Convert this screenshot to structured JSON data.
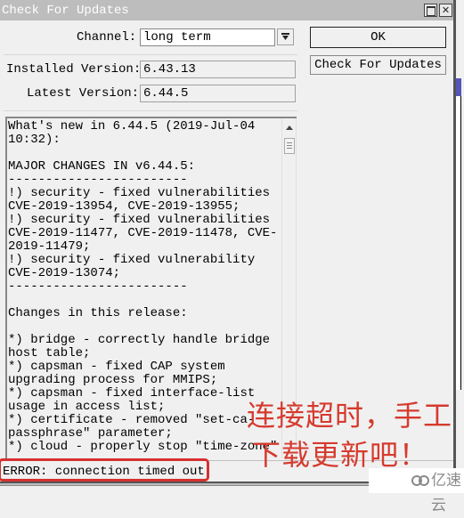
{
  "window": {
    "title": "Check For Updates",
    "maximize_icon": "maximize-icon",
    "close_glyph": "✕"
  },
  "form": {
    "channel_label": "Channel:",
    "channel_value": "long term",
    "installed_label": "Installed Version:",
    "installed_value": "6.43.13",
    "latest_label": "Latest Version:",
    "latest_value": "6.44.5"
  },
  "buttons": {
    "ok": "OK",
    "check": "Check For Updates"
  },
  "release_notes": {
    "text": "What's new in 6.44.5 (2019-Jul-04\n10:32):\n\nMAJOR CHANGES IN v6.44.5:\n------------------------\n!) security - fixed vulnerabilities\nCVE-2019-13954, CVE-2019-13955;\n!) security - fixed vulnerabilities\nCVE-2019-11477, CVE-2019-11478, CVE-\n2019-11479;\n!) security - fixed vulnerability\nCVE-2019-13074;\n------------------------\n\nChanges in this release:\n\n*) bridge - correctly handle bridge\nhost table;\n*) capsman - fixed CAP system\nupgrading process for MMIPS;\n*) capsman - fixed interface-list\nusage in access list;\n*) certificate - removed \"set-ca-\npassphrase\" parameter;\n*) cloud - properly stop \"time-zone\""
  },
  "status": {
    "text": "ERROR: connection timed out"
  },
  "annotation": {
    "line1": "连接超时，手工",
    "line2": "下载更新吧！",
    "color": "#d63a2e"
  },
  "watermark": {
    "text": "亿速云"
  }
}
